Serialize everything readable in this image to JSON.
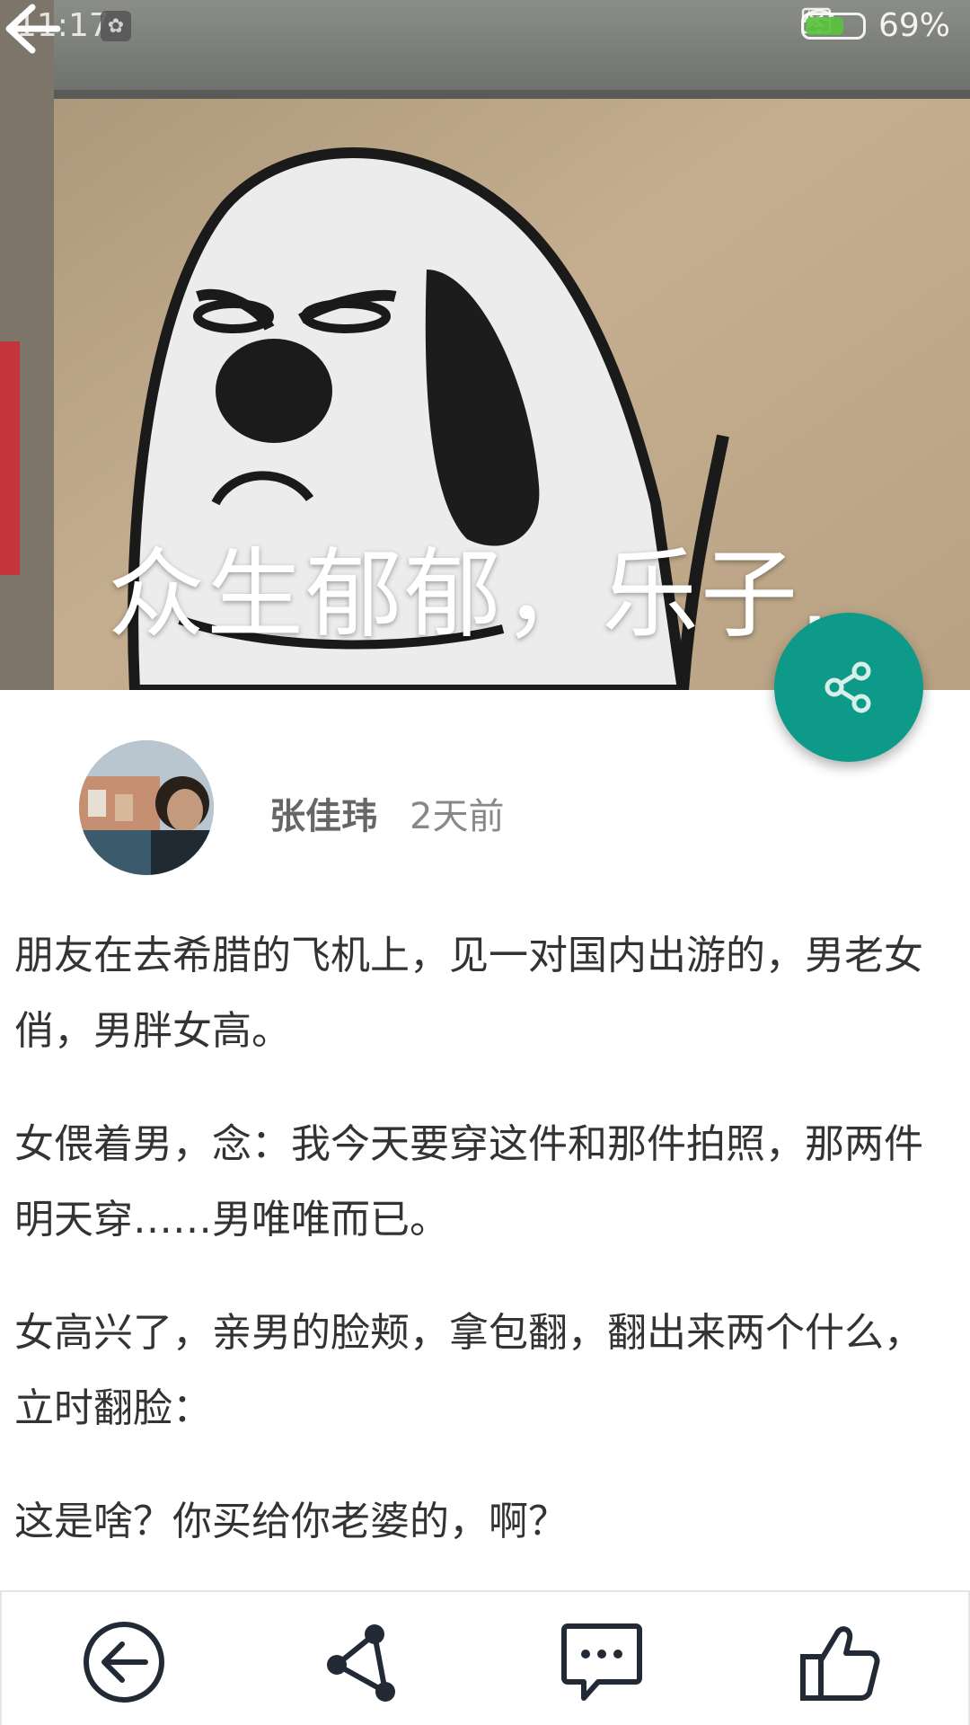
{
  "status_bar": {
    "time": "11:17",
    "battery_percent": "69%",
    "battery_level": 0.69,
    "icons": [
      "notification-app-icon",
      "wifi-icon",
      "no-sim-icon",
      "charging-icon",
      "battery-icon"
    ]
  },
  "hero": {
    "title": "众生郁郁，乐子...",
    "image_description_icon": "graffiti-dog-image"
  },
  "author": {
    "name": "张佳玮",
    "time_ago": "2天前"
  },
  "article": {
    "paragraphs": [
      "朋友在去希腊的飞机上，见一对国内出游的，男老女俏，男胖女高。",
      "女偎着男，念：我今天要穿这件和那件拍照，那两件明天穿……男唯唯而已。",
      "女高兴了，亲男的脸颊，拿包翻，翻出来两个什么，立时翻脸：",
      "这是啥？你买给你老婆的，啊？"
    ]
  },
  "fab": {
    "icon": "share-icon",
    "color": "#0d9a88"
  },
  "bottom_bar": {
    "buttons": [
      {
        "name": "back-button",
        "icon": "circle-arrow-left-icon"
      },
      {
        "name": "share-button",
        "icon": "share-nodes-icon"
      },
      {
        "name": "comment-button",
        "icon": "comment-bubble-icon"
      },
      {
        "name": "like-button",
        "icon": "thumbs-up-icon"
      }
    ]
  }
}
